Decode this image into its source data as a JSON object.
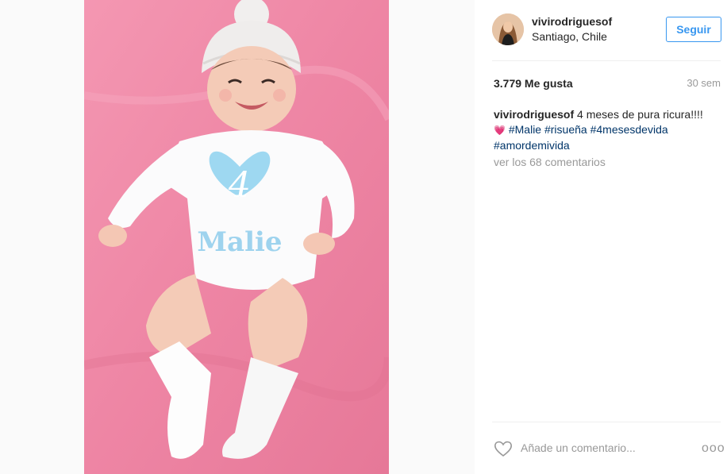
{
  "post": {
    "author": {
      "username": "vivirodriguesof",
      "location": "Santiago, Chile"
    },
    "follow_label": "Seguir",
    "likes_text": "3.779 Me gusta",
    "time_ago": "30 sem",
    "caption": {
      "username": "vivirodriguesof",
      "text": " 4 meses de pura ricura!!!!",
      "emoji": "💗",
      "hashtags": [
        "#Malie",
        "#risueña",
        "#4mesesdevida",
        "#amordemivida"
      ]
    },
    "view_comments_text": "ver los 68 comentarios",
    "comment_placeholder": "Añade un comentario...",
    "more_label": "ooo"
  },
  "photo": {
    "shirt_text": "Malie",
    "heart_number": "4"
  },
  "colors": {
    "accent": "#3897f0",
    "hashtag": "#003569",
    "muted": "#999999",
    "photo_background": "#f08caa"
  }
}
